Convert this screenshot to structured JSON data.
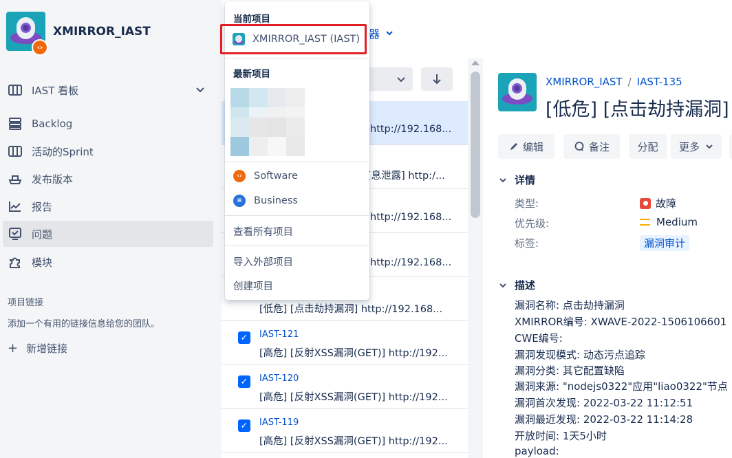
{
  "project": {
    "name": "XMIRROR_IAST"
  },
  "sidebar": {
    "board_label": "IAST 看板",
    "items": [
      {
        "label": "Backlog"
      },
      {
        "label": "活动的Sprint"
      },
      {
        "label": "发布版本"
      },
      {
        "label": "报告"
      },
      {
        "label": "问题"
      },
      {
        "label": "模块"
      }
    ],
    "links_title": "项目链接",
    "links_desc": "添加一个有用的链接信息给您的团队。",
    "add_link": "新增链接"
  },
  "list": {
    "breadcrumb_tail": "器",
    "rows": [
      {
        "summary_tail": "http://192.168..."
      },
      {
        "summary_tail": "[息泄露] http:/..."
      },
      {
        "summary_tail": "http://192.168..."
      },
      {
        "summary_tail": "http://192.168..."
      },
      {
        "summary": "[低危] [点击劫持漏洞] http://192.168..."
      },
      {
        "key": "IAST-121",
        "summary": "[高危] [反射XSS漏洞(GET)] http://192..."
      },
      {
        "key": "IAST-120",
        "summary": "[高危] [反射XSS漏洞(GET)] http://192..."
      },
      {
        "key": "IAST-119",
        "summary": "[高危] [反射XSS漏洞(GET)] http://192..."
      }
    ]
  },
  "dropdown": {
    "current_heading": "当前项目",
    "current_project": "XMIRROR_IAST (IAST)",
    "recent_heading": "最新项目",
    "categories": [
      {
        "label": "Software",
        "color": "#f1690e"
      },
      {
        "label": "Business",
        "color": "#2a6fdb"
      }
    ],
    "view_all": "查看所有项目",
    "import": "导入外部项目",
    "create": "创建项目"
  },
  "detail": {
    "breadcrumb": {
      "project": "XMIRROR_IAST",
      "issue": "IAST-135"
    },
    "title": "[低危] [点击劫持漏洞]",
    "buttons": {
      "edit": "编辑",
      "comment": "备注",
      "assign": "分配",
      "more": "更多"
    },
    "details_heading": "详情",
    "fields": {
      "type_label": "类型:",
      "type_value": "故障",
      "priority_label": "优先级:",
      "priority_value": "Medium",
      "tags_label": "标签:",
      "tags_value": "漏洞审计"
    },
    "description_heading": "描述",
    "description_lines": [
      "漏洞名称:  点击劫持漏洞",
      "XMIRROR编号:  XWAVE-2022-1506106601",
      "CWE编号:",
      "漏洞发现模式:  动态污点追踪",
      "漏洞分类:  其它配置缺陷",
      "漏洞来源:  \"nodejs0322\"应用\"liao0322\"节点",
      "漏洞首次发现:  2022-03-22 11:12:51",
      "漏洞最近发现:  2022-03-22 11:14:28",
      "开放时间:  1天5小时",
      "payload:"
    ]
  }
}
